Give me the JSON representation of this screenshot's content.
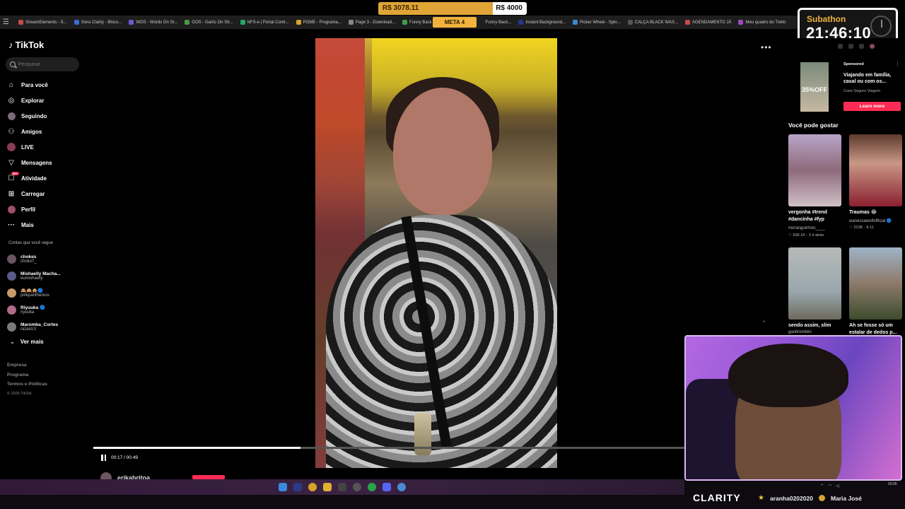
{
  "bookmarks": [
    "StreamElements - S...",
    "Sons Clarity - Bloco...",
    "WOS - Words On St...",
    "GOS - Gartic On Str...",
    "NFS-e | Portal Contr...",
    "PGME - Programa...",
    "Page 3 - Download...",
    "Funny Back",
    "Funny Back...",
    "Instant Background...",
    "Picker Wheel - Spin...",
    "CALÇA BLACK WAS...",
    "AGENDAMENTO JÁ",
    "Meu quadro do Trello"
  ],
  "goal": {
    "current": "R$ 3078.11",
    "target": "R$ 4000",
    "progress": 0.77,
    "meta_label": "META 4"
  },
  "subathon": {
    "label": "Subathon",
    "time": "21:46:10"
  },
  "tiktok": {
    "logo": "TikTok",
    "search_placeholder": "Pesquisar",
    "nav": [
      {
        "label": "Para você",
        "icon": "home-icon"
      },
      {
        "label": "Explorar",
        "icon": "compass-icon"
      },
      {
        "label": "Seguindo",
        "icon": "following-icon"
      },
      {
        "label": "Amigos",
        "icon": "friends-icon"
      },
      {
        "label": "LIVE",
        "icon": "live-icon"
      },
      {
        "label": "Mensagens",
        "icon": "message-icon"
      },
      {
        "label": "Atividade",
        "icon": "activity-icon",
        "badge": "99+"
      },
      {
        "label": "Carregar",
        "icon": "upload-icon"
      },
      {
        "label": "Perfil",
        "icon": "profile-icon"
      },
      {
        "label": "Mais",
        "icon": "more-icon"
      }
    ],
    "following_title": "Contas que você segue",
    "following": [
      {
        "name": "chokes",
        "handle": "choko7_"
      },
      {
        "name": "Mishaelly Macha...",
        "handle": "eumishaelly"
      },
      {
        "name": "🙈🙉🙊🔵",
        "handle": "pinkpantheress"
      },
      {
        "name": "Riyuuka 🔵",
        "handle": "riyuuka"
      },
      {
        "name": "Maromba_Cortes",
        "handle": "razard.0"
      }
    ],
    "see_more": "Ver mais",
    "footer": [
      "Empresa",
      "Programa",
      "Termos e Políticas"
    ],
    "copyright": "© 2025 TikTok"
  },
  "player": {
    "time": "00:17 / 00:49",
    "progress": 0.35,
    "author": "erikabritoa"
  },
  "ad": {
    "sponsored": "Sponsored",
    "badge": "35%OFF",
    "title": "Viajando em família, casal ou com os...",
    "brand": "Coris Seguro Viagem",
    "cta": "Learn more"
  },
  "recommend_title": "Você pode gostar",
  "recommendations": [
    {
      "caption": "vergonha #trend #dancinha #fyp",
      "author": "moranguinhoo____",
      "likes": "636.1K",
      "age": "3 d atrás"
    },
    {
      "caption": "Traumas 😂",
      "author": "wanessawolfofficial 🔵",
      "likes": "223K",
      "age": "9-11"
    },
    {
      "caption": "sendo assim, slim",
      "author": "gaoltrombini"
    },
    {
      "caption": "Ah se fosse só um estalar de dedos p..."
    }
  ],
  "stream": {
    "brand": "CLARITY",
    "ticker": [
      {
        "icon": "star-icon",
        "text": "aranha0202020"
      },
      {
        "icon": "coin-icon",
        "text": "Maria José"
      }
    ]
  },
  "taskbar_time": "03:05",
  "colors": {
    "accent": "#fe2c55",
    "goal": "#e0a437",
    "subathon_label": "#f2b33d"
  }
}
